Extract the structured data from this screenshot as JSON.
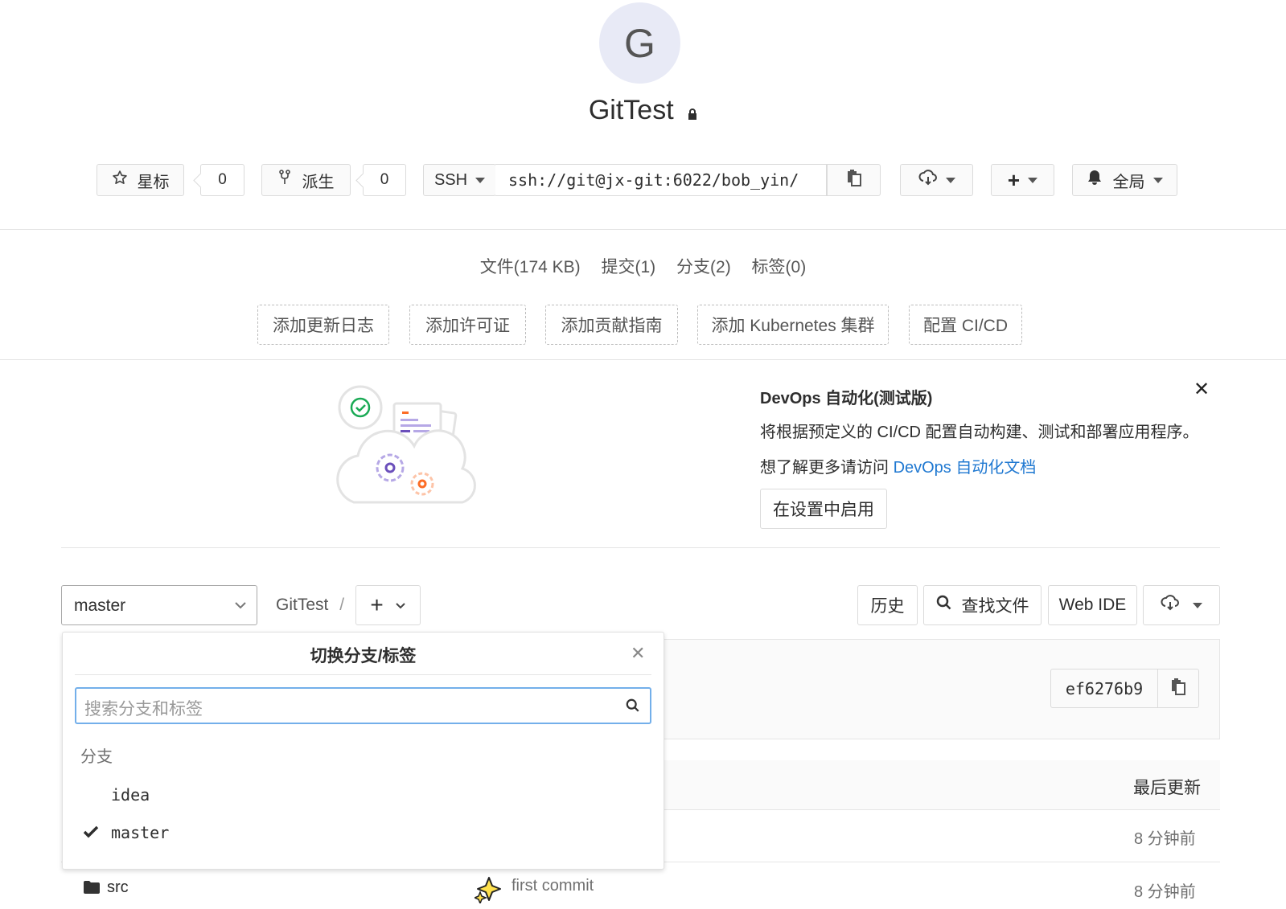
{
  "project": {
    "avatar_letter": "G",
    "name": "GitTest",
    "star_label": "星标",
    "star_count": "0",
    "fork_label": "派生",
    "fork_count": "0",
    "clone_protocol": "SSH",
    "clone_url": "ssh://git@jx-git:6022/bob_yin/",
    "notification_label": "全局"
  },
  "stats": {
    "files": "文件(174 KB)",
    "commits": "提交(1)",
    "branches": "分支(2)",
    "tags": "标签(0)"
  },
  "quick_actions": [
    "添加更新日志",
    "添加许可证",
    "添加贡献指南",
    "添加 Kubernetes 集群",
    "配置 CI/CD"
  ],
  "devops": {
    "title": "DevOps 自动化(测试版)",
    "description": "将根据预定义的 CI/CD 配置自动构建、测试和部署应用程序。",
    "learn_more_prefix": "想了解更多请访问 ",
    "learn_more_link": "DevOps 自动化文档",
    "enable_button": "在设置中启用"
  },
  "toolbar": {
    "branch_selected": "master",
    "breadcrumb": "GitTest",
    "breadcrumb_sep": "/",
    "history": "历史",
    "find_file": "查找文件",
    "web_ide": "Web IDE"
  },
  "branch_dropdown": {
    "title": "切换分支/标签",
    "search_placeholder": "搜索分支和标签",
    "section_label": "分支",
    "branches": [
      {
        "name": "idea",
        "selected": false
      },
      {
        "name": "master",
        "selected": true
      }
    ]
  },
  "commit": {
    "sha": "ef6276b9"
  },
  "file_table": {
    "last_update_header": "最后更新",
    "rows": [
      {
        "name": "",
        "message": "",
        "updated": "8 分钟前"
      },
      {
        "name": "src",
        "message": "first commit",
        "updated": "8 分钟前"
      }
    ]
  },
  "colors": {
    "link": "#1f78d1",
    "search_focus_border": "#73afea",
    "avatar_bg": "#e8eaf6"
  }
}
